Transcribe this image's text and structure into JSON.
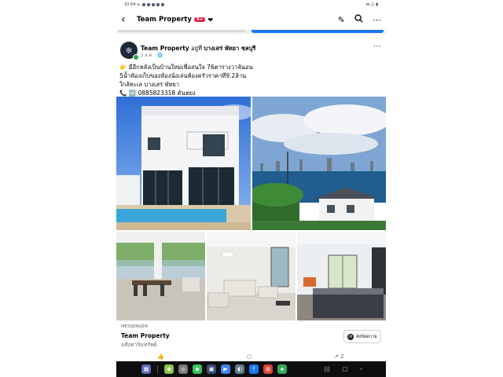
{
  "status_bar": {
    "time": "10:54 น.",
    "right_icons": "⋈ ◫ ▮"
  },
  "app_bar": {
    "title": "Team Property",
    "badge": "9+",
    "caret": "▾"
  },
  "post": {
    "page_name": "Team Property",
    "location_prefix": "อยู่ที่",
    "location": "บางเสร่ พัทยา ชลบุรี",
    "meta": "2 ส.ค. · 🌐",
    "lines": [
      "👉 มีอีกหลังเป็นบ้านใหม่เพื่อสนใจ 76ตารางวา4นอน",
      "5น้ำห้องเก็บของห้องนั่งเล่นห้องครัวราคาที่9.2ล้าน",
      "ใกล้ทะเล บางเสร่ พัทยา",
      "📞 🆗 0885823318 คันหยง"
    ]
  },
  "cta": {
    "label": "MESSENGER",
    "name": "Team Property",
    "sub": "อสังหาริมทรัพย์",
    "button": "ส่งข้อความ"
  },
  "reactions": {
    "like": "👍",
    "comment": "○",
    "share_count": "2"
  },
  "colors": {
    "accent": "#1877f2",
    "badge": "#e41e3f",
    "online": "#31a24c"
  }
}
